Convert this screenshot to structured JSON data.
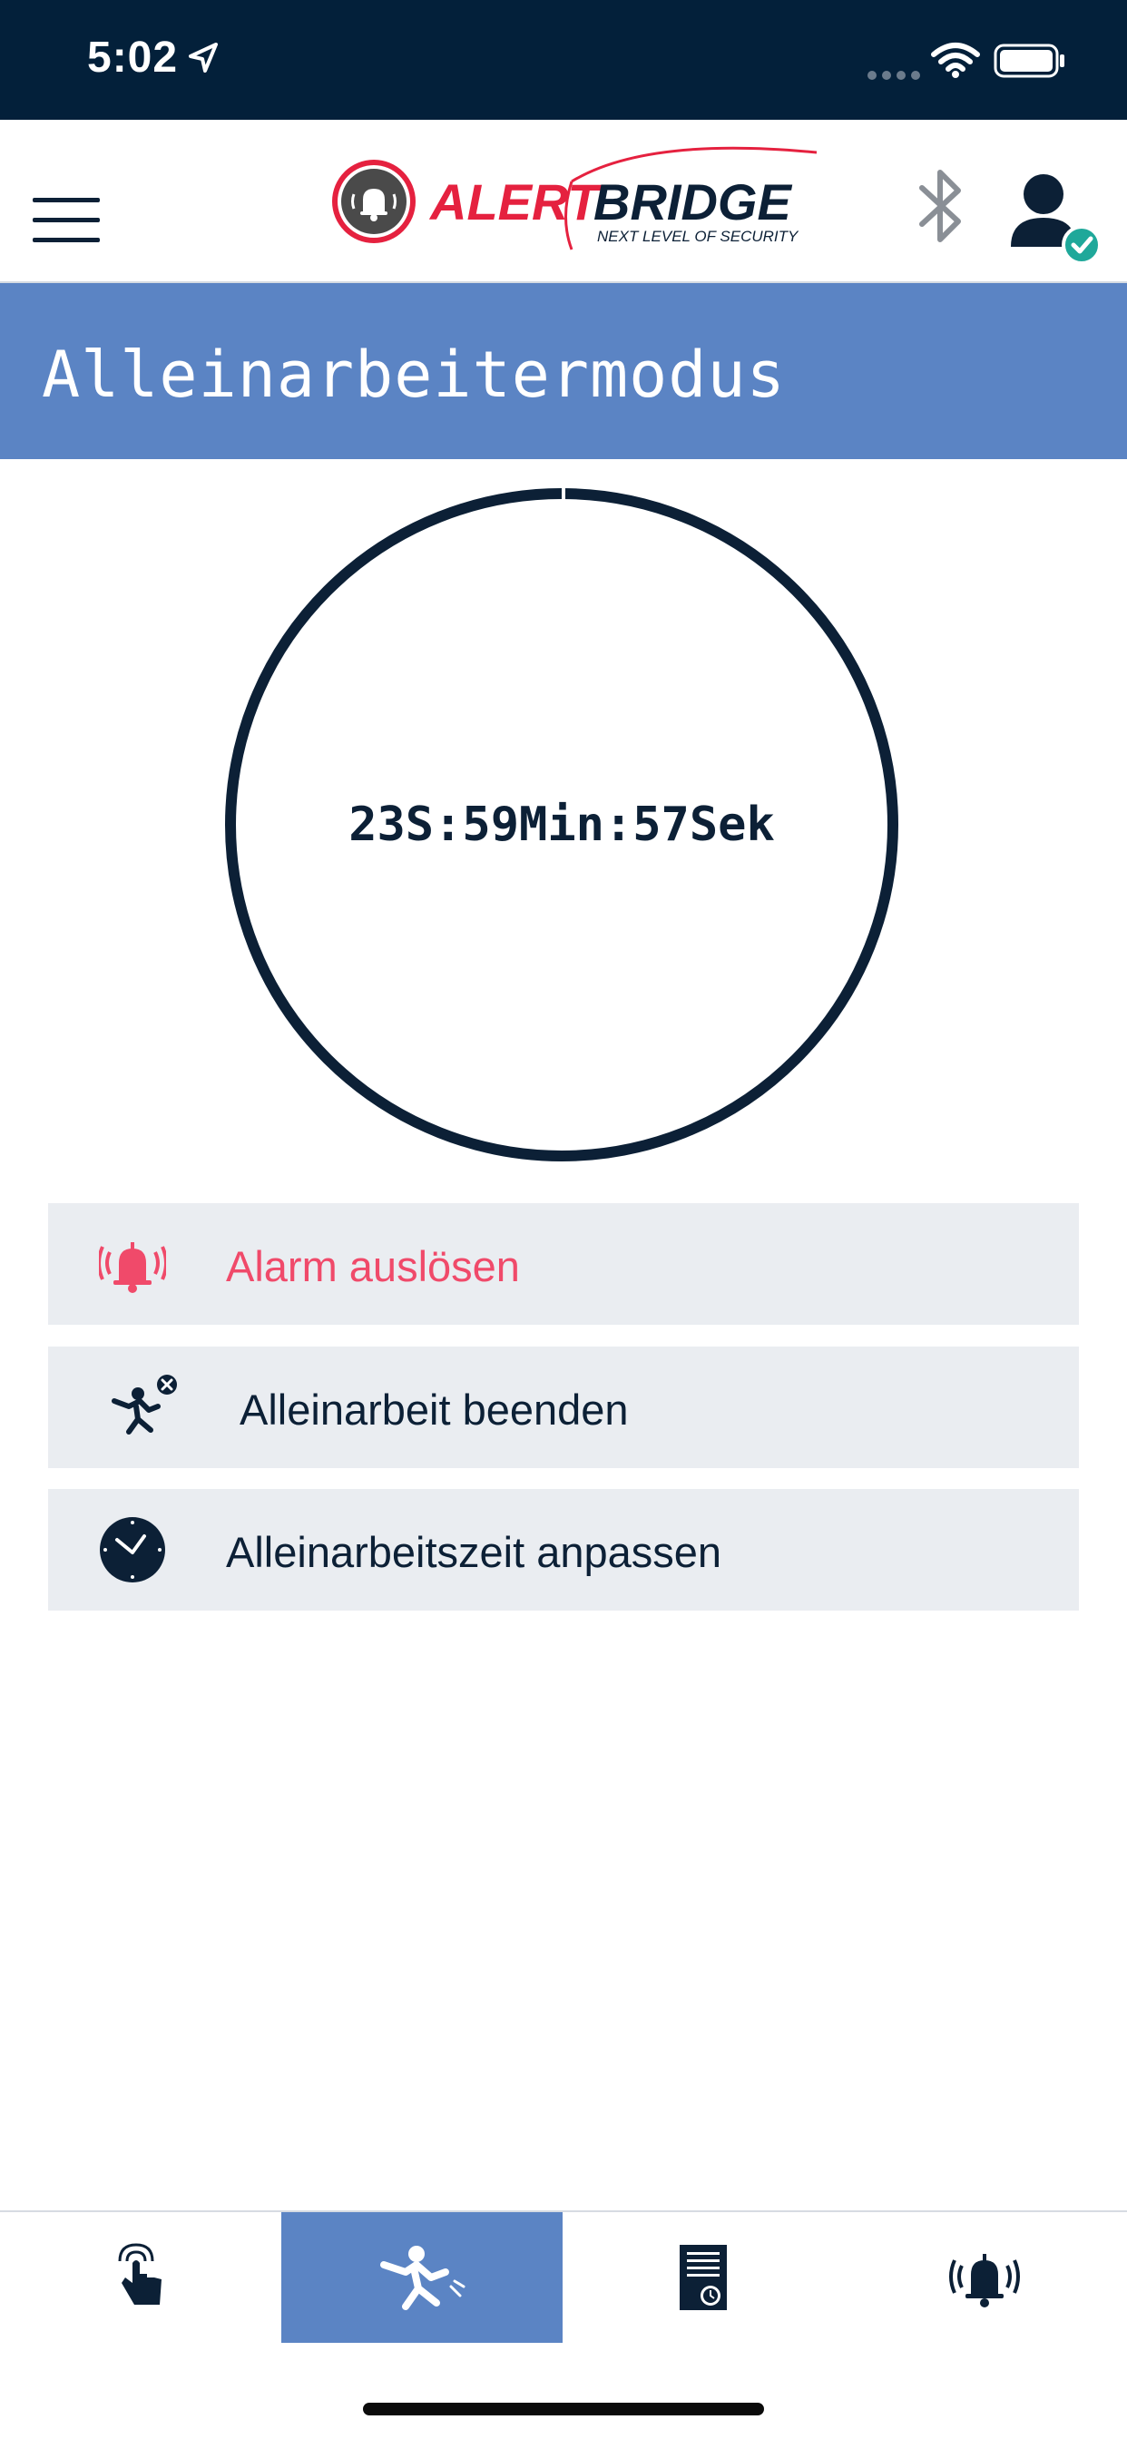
{
  "status_bar": {
    "time": "5:02",
    "icons": [
      "location-arrow-icon",
      "cellular-signal-icon",
      "wifi-icon",
      "battery-icon"
    ]
  },
  "header": {
    "logo": {
      "brand_part1": "ALERT",
      "brand_part2": "BRIDGE",
      "tagline": "NEXT LEVEL OF SECURITY"
    },
    "icons": [
      "menu-icon",
      "bluetooth-icon",
      "user-verified-icon"
    ]
  },
  "page": {
    "title": "Alleinarbeitermodus"
  },
  "timer": {
    "display": "23S:59Min:57Sek"
  },
  "actions": [
    {
      "label": "Alarm auslösen",
      "icon": "alarm-bell-icon"
    },
    {
      "label": "Alleinarbeit beenden",
      "icon": "fall-person-cancel-icon"
    },
    {
      "label": "Alleinarbeitszeit anpassen",
      "icon": "clock-icon"
    }
  ],
  "bottom_nav": {
    "tabs": [
      {
        "icon": "touch-hand-icon",
        "active": false
      },
      {
        "icon": "falling-person-icon",
        "active": true
      },
      {
        "icon": "document-clock-icon",
        "active": false
      },
      {
        "icon": "alarm-bell-icon",
        "active": false
      }
    ]
  },
  "colors": {
    "status_bar": "#03203a",
    "accent_blue": "#5b84c4",
    "navy": "#0c2036",
    "alarm_red": "#f04a6a",
    "row_bg": "#eaedf1",
    "verified_teal": "#1fa89a"
  }
}
